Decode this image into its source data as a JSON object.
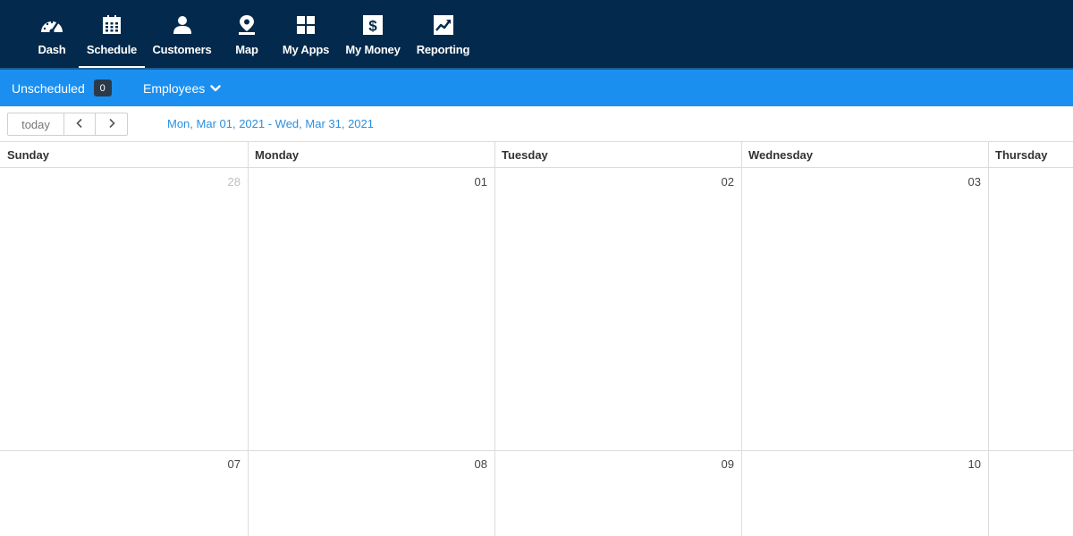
{
  "nav": {
    "items": [
      {
        "label": "Dash",
        "icon": "speedometer-icon"
      },
      {
        "label": "Schedule",
        "icon": "calendar-icon",
        "active": true
      },
      {
        "label": "Customers",
        "icon": "person-icon"
      },
      {
        "label": "Map",
        "icon": "map-pin-icon"
      },
      {
        "label": "My Apps",
        "icon": "grid-icon"
      },
      {
        "label": "My Money",
        "icon": "dollar-icon"
      },
      {
        "label": "Reporting",
        "icon": "trend-icon"
      }
    ]
  },
  "subnav": {
    "unscheduled_label": "Unscheduled",
    "unscheduled_count": "0",
    "employees_label": "Employees"
  },
  "toolbar": {
    "today_label": "today",
    "range_label": "Mon, Mar 01, 2021 - Wed, Mar 31, 2021"
  },
  "calendar": {
    "day_headers": [
      "Sunday",
      "Monday",
      "Tuesday",
      "Wednesday",
      "Thursday"
    ],
    "weeks": [
      [
        "28",
        "01",
        "02",
        "03"
      ],
      [
        "07",
        "08",
        "09",
        "10"
      ]
    ]
  },
  "colors": {
    "nav_bg": "#032a4c",
    "subnav_bg": "#1a8ff0",
    "range_text": "#2a8fe0"
  }
}
